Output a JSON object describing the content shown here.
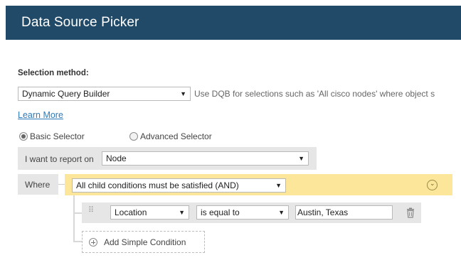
{
  "header": {
    "title": "Data Source Picker"
  },
  "selection": {
    "label": "Selection method:",
    "method_value": "Dynamic Query Builder",
    "hint": "Use DQB for selections such as 'All cisco nodes' where object s",
    "learn_more": "Learn More"
  },
  "mode": {
    "basic_label": "Basic Selector",
    "advanced_label": "Advanced Selector",
    "selected": "Basic Selector"
  },
  "report": {
    "label": "I want to report on",
    "entity_value": "Node"
  },
  "where": {
    "label": "Where",
    "group_operator": "All child conditions must be satisfied (AND)"
  },
  "condition": {
    "field": "Location",
    "operator": "is equal to",
    "value": "Austin, Texas"
  },
  "add_condition": {
    "label": "Add Simple Condition"
  },
  "colors": {
    "header_bg": "#204a67",
    "and_bar_bg": "#fce69a",
    "panel_bg": "#e6e6e6",
    "link": "#2d7bb8"
  }
}
